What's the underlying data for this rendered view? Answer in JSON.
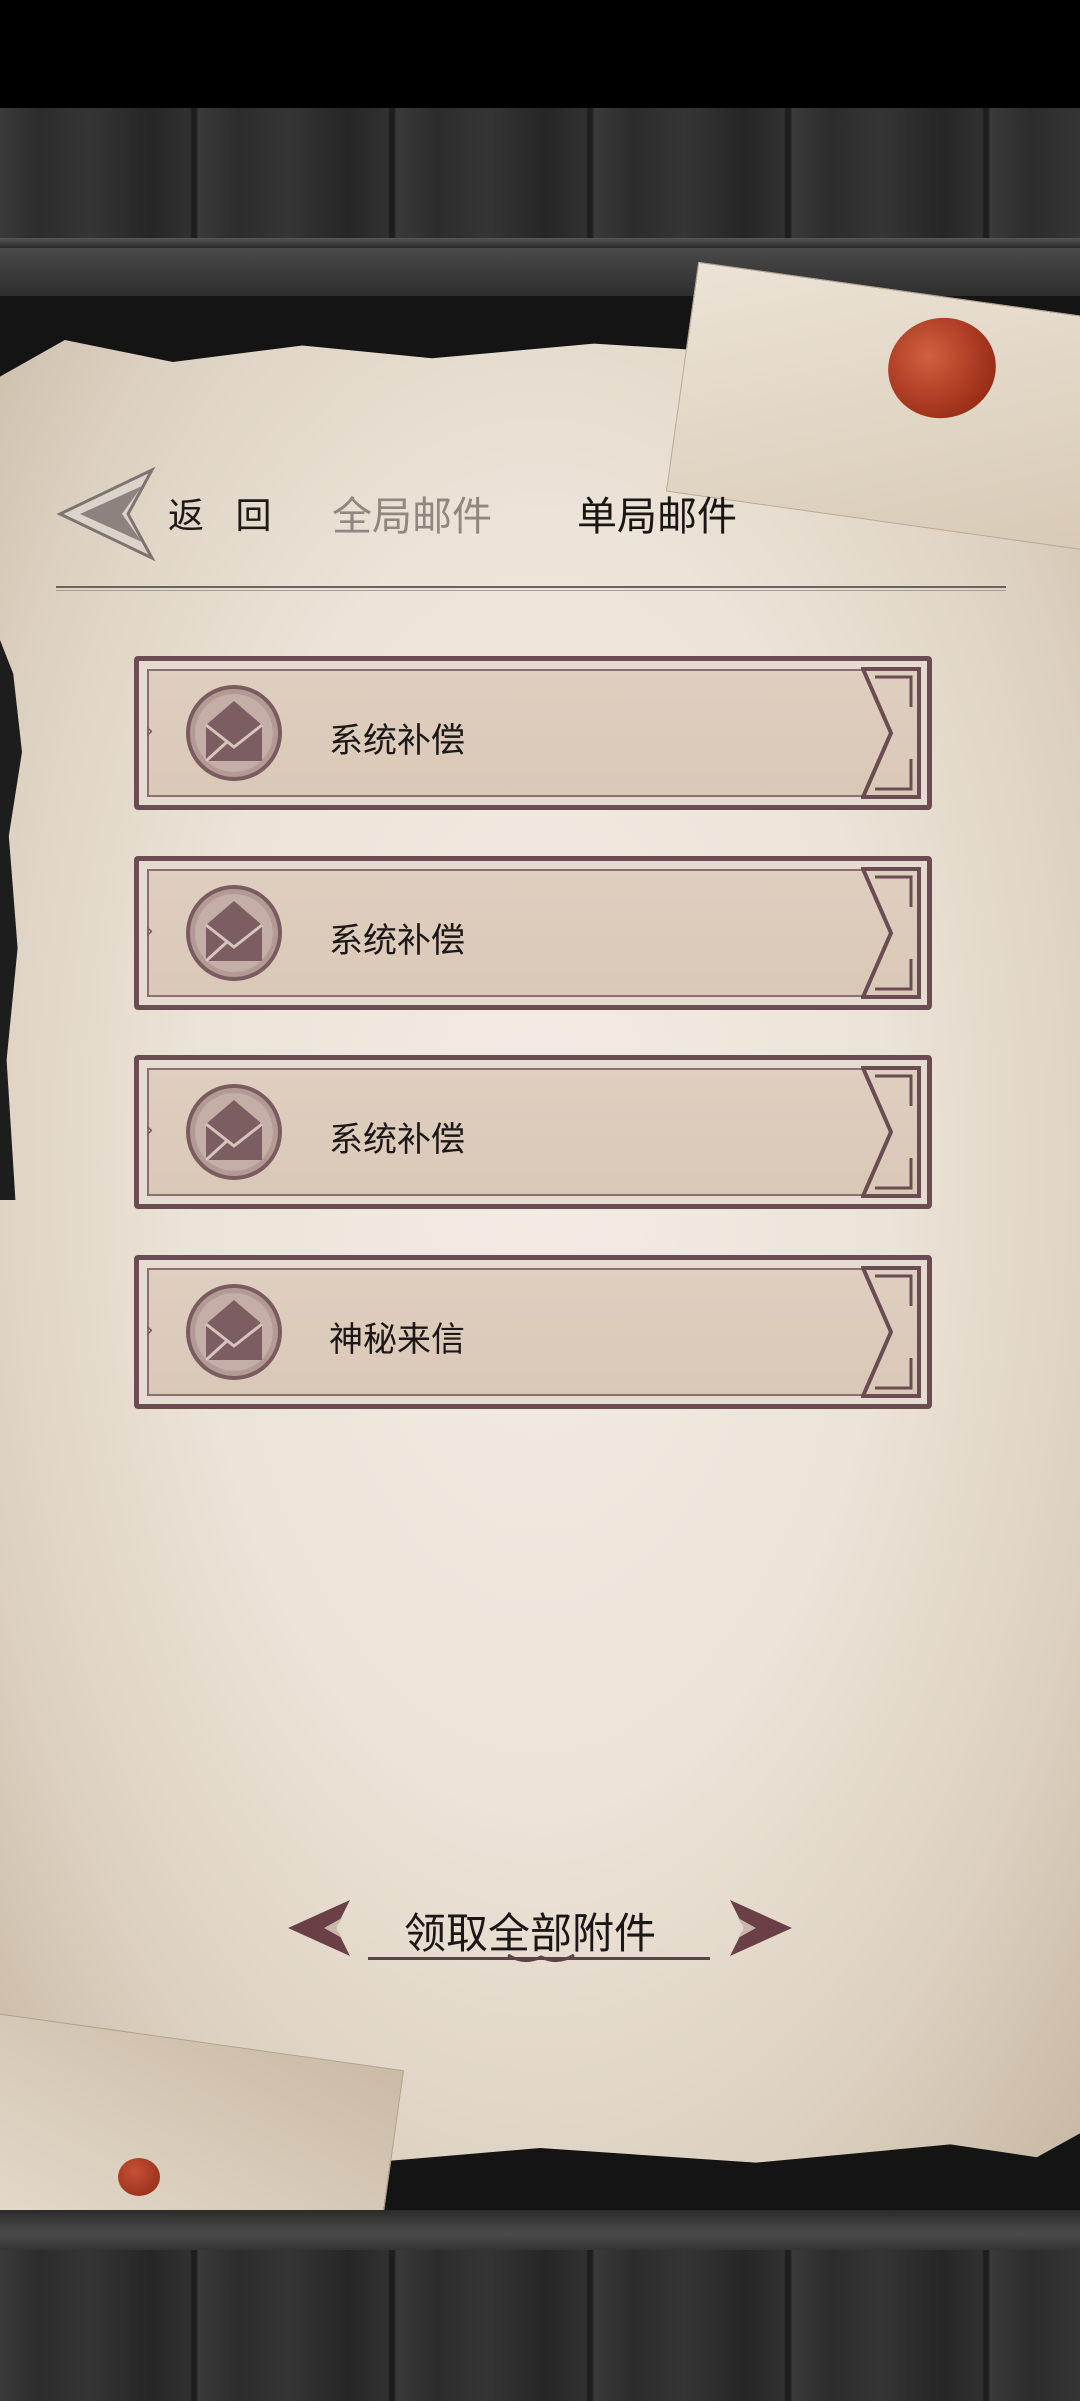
{
  "header": {
    "back_label": "返 回",
    "tabs": [
      {
        "label": "全局邮件",
        "active": false
      },
      {
        "label": "单局邮件",
        "active": true
      }
    ]
  },
  "mails": [
    {
      "title": "系统补偿",
      "icon": "envelope-icon"
    },
    {
      "title": "系统补偿",
      "icon": "envelope-icon"
    },
    {
      "title": "系统补偿",
      "icon": "envelope-icon"
    },
    {
      "title": "神秘来信",
      "icon": "envelope-icon"
    }
  ],
  "footer": {
    "claim_all_label": "领取全部附件"
  },
  "colors": {
    "accent_frame": "#6a4c52",
    "parchment": "#ece4d8",
    "wax_seal": "#a2331c"
  }
}
